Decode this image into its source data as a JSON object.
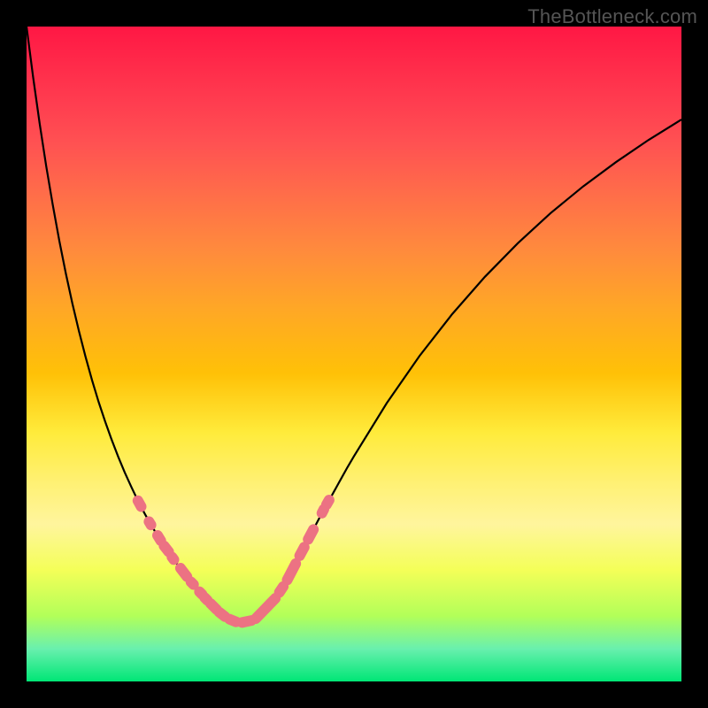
{
  "watermark": "TheBottleneck.com",
  "colors": {
    "frame": "#000000",
    "curve": "#000000",
    "segment": "#ec7283",
    "gradient_top": "#ff1744",
    "gradient_mid": "#ffeb3b",
    "gradient_bottom": "#00e676"
  },
  "chart_data": {
    "type": "line",
    "title": "",
    "xlabel": "",
    "ylabel": "",
    "xlim": [
      0,
      100
    ],
    "ylim": [
      0,
      100
    ],
    "x": [
      0,
      1,
      2,
      3,
      4,
      5,
      6,
      7,
      8,
      9,
      10,
      11,
      12,
      13,
      14,
      15,
      16,
      17,
      18,
      19,
      20,
      21,
      22,
      23,
      24,
      25,
      26,
      27,
      28,
      29,
      30,
      31,
      32,
      33,
      34,
      35,
      36,
      37,
      38,
      39,
      40,
      41,
      42,
      43,
      44,
      45,
      46,
      47,
      48,
      49,
      50,
      55,
      60,
      65,
      70,
      75,
      80,
      85,
      90,
      95,
      100
    ],
    "y": [
      100,
      92.3,
      85.2,
      78.7,
      72.8,
      67.3,
      62.3,
      57.7,
      53.5,
      49.6,
      46.0,
      42.7,
      39.7,
      36.9,
      34.3,
      31.9,
      29.7,
      27.6,
      25.7,
      23.9,
      22.3,
      20.7,
      19.3,
      17.9,
      16.6,
      15.4,
      14.2,
      13.1,
      12.0,
      11.0,
      10.1,
      9.5,
      9.1,
      9.0,
      9.2,
      9.6,
      10.4,
      11.4,
      12.7,
      14.2,
      16.0,
      17.9,
      19.8,
      21.7,
      23.6,
      25.5,
      27.3,
      29.1,
      30.9,
      32.7,
      34.4,
      42.5,
      49.7,
      56.1,
      61.8,
      66.9,
      71.5,
      75.6,
      79.3,
      82.7,
      85.8
    ],
    "highlighted_segments": [
      {
        "x0": 17.0,
        "y0": 27.6,
        "x1": 17.5,
        "y1": 26.7
      },
      {
        "x0": 18.7,
        "y0": 24.4,
        "x1": 19.0,
        "y1": 23.9
      },
      {
        "x0": 20.0,
        "y0": 22.3,
        "x1": 20.5,
        "y1": 21.5
      },
      {
        "x0": 21.0,
        "y0": 20.7,
        "x1": 21.7,
        "y1": 19.8
      },
      {
        "x0": 22.2,
        "y0": 19.0,
        "x1": 22.5,
        "y1": 18.6
      },
      {
        "x0": 23.5,
        "y0": 17.3,
        "x1": 24.5,
        "y1": 16.0
      },
      {
        "x0": 25.1,
        "y0": 15.2,
        "x1": 25.5,
        "y1": 14.8
      },
      {
        "x0": 26.4,
        "y0": 13.7,
        "x1": 26.8,
        "y1": 13.3
      },
      {
        "x0": 27.2,
        "y0": 12.8,
        "x1": 27.6,
        "y1": 12.4
      },
      {
        "x0": 28.1,
        "y0": 11.9,
        "x1": 29.0,
        "y1": 11.0
      },
      {
        "x0": 29.4,
        "y0": 10.6,
        "x1": 30.3,
        "y1": 9.9
      },
      {
        "x0": 31.0,
        "y0": 9.5,
        "x1": 32.0,
        "y1": 9.1
      },
      {
        "x0": 32.9,
        "y0": 9.0,
        "x1": 34.3,
        "y1": 9.3
      },
      {
        "x0": 35.0,
        "y0": 9.6,
        "x1": 38.0,
        "y1": 12.7
      },
      {
        "x0": 38.6,
        "y0": 13.6,
        "x1": 39.2,
        "y1": 14.5
      },
      {
        "x0": 39.8,
        "y0": 15.5,
        "x1": 41.1,
        "y1": 18.0
      },
      {
        "x0": 41.7,
        "y0": 19.2,
        "x1": 42.4,
        "y1": 20.5
      },
      {
        "x0": 43.0,
        "y0": 21.7,
        "x1": 43.8,
        "y1": 23.2
      },
      {
        "x0": 45.1,
        "y0": 25.7,
        "x1": 45.4,
        "y1": 26.3
      },
      {
        "x0": 45.8,
        "y0": 27.0,
        "x1": 46.2,
        "y1": 27.7
      }
    ]
  }
}
